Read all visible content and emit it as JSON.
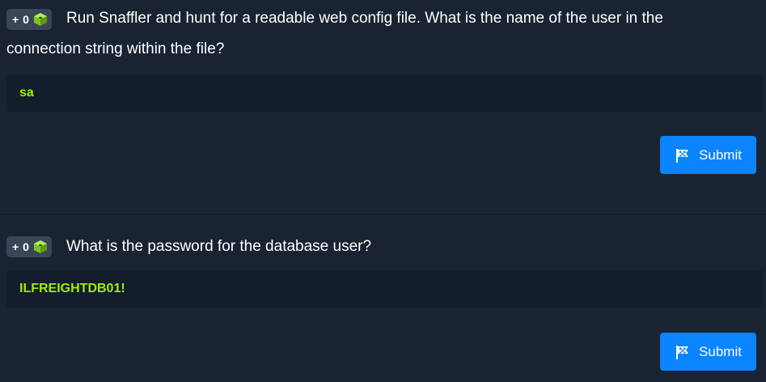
{
  "questions": [
    {
      "points_badge": "+ 0",
      "badge_icon": "green-cube-icon",
      "text": "Run Snaffler and hunt for a readable web config file. What is the name of the user in the connection string within the file?",
      "answer": "sa",
      "submit_label": "Submit",
      "submit_icon": "flag-icon"
    },
    {
      "points_badge": "+ 0",
      "badge_icon": "green-cube-icon",
      "text": "What is the password for the database user?",
      "answer": "ILFREIGHTDB01!",
      "submit_label": "Submit",
      "submit_icon": "flag-icon"
    }
  ],
  "colors": {
    "background": "#1a2332",
    "answer_background": "#141d2b",
    "answer_text": "#9fef00",
    "button": "#0a84ff",
    "badge": "#3a4658"
  }
}
